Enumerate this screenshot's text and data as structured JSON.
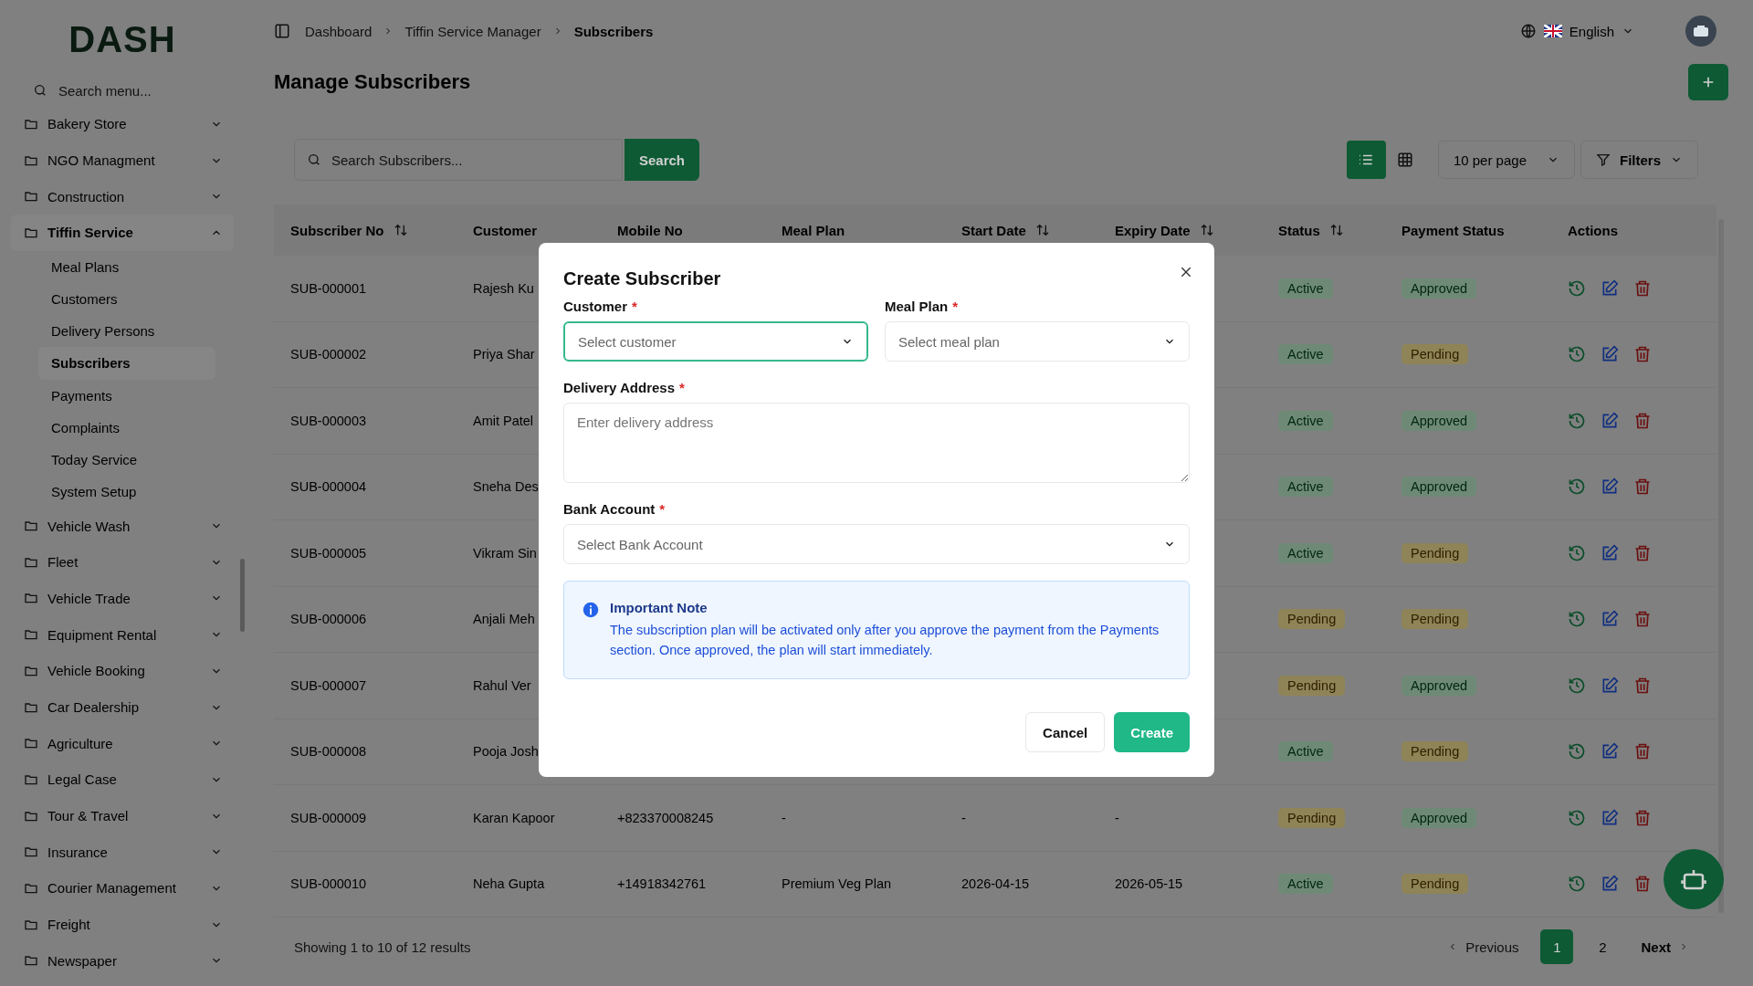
{
  "sidebar": {
    "logo": "DASH",
    "search_placeholder": "Search menu...",
    "items": [
      {
        "label": "Bakery Store",
        "expanded": false
      },
      {
        "label": "NGO Managment",
        "expanded": false
      },
      {
        "label": "Construction",
        "expanded": false
      },
      {
        "label": "Tiffin Service",
        "expanded": true,
        "children": [
          {
            "label": "Meal Plans",
            "selected": false
          },
          {
            "label": "Customers",
            "selected": false
          },
          {
            "label": "Delivery Persons",
            "selected": false
          },
          {
            "label": "Subscribers",
            "selected": true
          },
          {
            "label": "Payments",
            "selected": false
          },
          {
            "label": "Complaints",
            "selected": false
          },
          {
            "label": "Today Service",
            "selected": false
          },
          {
            "label": "System Setup",
            "selected": false
          }
        ]
      },
      {
        "label": "Vehicle Wash",
        "expanded": false
      },
      {
        "label": "Fleet",
        "expanded": false
      },
      {
        "label": "Vehicle Trade",
        "expanded": false
      },
      {
        "label": "Equipment Rental",
        "expanded": false
      },
      {
        "label": "Vehicle Booking",
        "expanded": false
      },
      {
        "label": "Car Dealership",
        "expanded": false
      },
      {
        "label": "Agriculture",
        "expanded": false
      },
      {
        "label": "Legal Case",
        "expanded": false
      },
      {
        "label": "Tour & Travel",
        "expanded": false
      },
      {
        "label": "Insurance",
        "expanded": false
      },
      {
        "label": "Courier Management",
        "expanded": false
      },
      {
        "label": "Freight",
        "expanded": false
      },
      {
        "label": "Newspaper",
        "expanded": false
      }
    ]
  },
  "header": {
    "breadcrumb": [
      "Dashboard",
      "Tiffin Service Manager",
      "Subscribers"
    ],
    "language": "English"
  },
  "page_title": "Manage Subscribers",
  "toolbar": {
    "search_placeholder": "Search Subscribers...",
    "search_button": "Search",
    "views": [
      {
        "kind": "list",
        "selected": true
      },
      {
        "kind": "grid",
        "selected": false
      }
    ],
    "per_page": "10 per page",
    "filters": "Filters"
  },
  "table": {
    "columns": [
      {
        "label": "Subscriber No",
        "sortable": true
      },
      {
        "label": "Customer",
        "sortable": false
      },
      {
        "label": "Mobile No",
        "sortable": false
      },
      {
        "label": "Meal Plan",
        "sortable": false
      },
      {
        "label": "Start Date",
        "sortable": true
      },
      {
        "label": "Expiry Date",
        "sortable": true
      },
      {
        "label": "Status",
        "sortable": true
      },
      {
        "label": "Payment Status",
        "sortable": false
      },
      {
        "label": "Actions",
        "sortable": false
      }
    ],
    "rows": [
      {
        "subscriber_no": "SUB-000001",
        "customer": "Rajesh Ku",
        "status": {
          "label": "Active",
          "kind": "success"
        },
        "payment_status": {
          "label": "Approved",
          "kind": "success"
        }
      },
      {
        "subscriber_no": "SUB-000002",
        "customer": "Priya Shar",
        "status": {
          "label": "Active",
          "kind": "success"
        },
        "payment_status": {
          "label": "Pending",
          "kind": "warning"
        }
      },
      {
        "subscriber_no": "SUB-000003",
        "customer": "Amit Patel",
        "status": {
          "label": "Active",
          "kind": "success"
        },
        "payment_status": {
          "label": "Approved",
          "kind": "success"
        }
      },
      {
        "subscriber_no": "SUB-000004",
        "customer": "Sneha Des",
        "status": {
          "label": "Active",
          "kind": "success"
        },
        "payment_status": {
          "label": "Approved",
          "kind": "success"
        }
      },
      {
        "subscriber_no": "SUB-000005",
        "customer": "Vikram Sin",
        "status": {
          "label": "Active",
          "kind": "success"
        },
        "payment_status": {
          "label": "Pending",
          "kind": "warning"
        }
      },
      {
        "subscriber_no": "SUB-000006",
        "customer": "Anjali Meh",
        "status": {
          "label": "Pending",
          "kind": "warning"
        },
        "payment_status": {
          "label": "Pending",
          "kind": "warning"
        }
      },
      {
        "subscriber_no": "SUB-000007",
        "customer": "Rahul Ver",
        "status": {
          "label": "Pending",
          "kind": "warning"
        },
        "payment_status": {
          "label": "Approved",
          "kind": "success"
        }
      },
      {
        "subscriber_no": "SUB-000008",
        "customer": "Pooja Josh",
        "status": {
          "label": "Active",
          "kind": "success"
        },
        "payment_status": {
          "label": "Pending",
          "kind": "warning"
        }
      },
      {
        "subscriber_no": "SUB-000009",
        "customer": "Karan Kapoor",
        "mobile_no": "+823370008245",
        "meal_plan": "-",
        "start_date": "-",
        "expiry_date": "-",
        "status": {
          "label": "Pending",
          "kind": "warning"
        },
        "payment_status": {
          "label": "Approved",
          "kind": "success"
        }
      },
      {
        "subscriber_no": "SUB-000010",
        "customer": "Neha Gupta",
        "mobile_no": "+14918342761",
        "meal_plan": "Premium Veg Plan",
        "start_date": "2026-04-15",
        "expiry_date": "2026-05-15",
        "status": {
          "label": "Active",
          "kind": "success"
        },
        "payment_status": {
          "label": "Pending",
          "kind": "warning"
        }
      }
    ]
  },
  "pagination": {
    "summary": "Showing 1 to 10 of 12 results",
    "previous": "Previous",
    "pages": [
      {
        "label": "1",
        "selected": true
      },
      {
        "label": "2",
        "selected": false
      }
    ],
    "next": "Next"
  },
  "modal": {
    "title": "Create Subscriber",
    "field_rows": [
      [
        {
          "kind": "select",
          "label": "Customer",
          "required_mark": "*",
          "placeholder": "Select customer",
          "focused": true
        },
        {
          "kind": "select",
          "label": "Meal Plan",
          "required_mark": "*",
          "placeholder": "Select meal plan",
          "focused": false
        }
      ],
      [
        {
          "kind": "textarea",
          "label": "Delivery Address",
          "required_mark": "*",
          "placeholder": "Enter delivery address",
          "focused": false
        }
      ],
      [
        {
          "kind": "select",
          "label": "Bank Account",
          "required_mark": "*",
          "placeholder": "Select Bank Account",
          "focused": false
        }
      ]
    ],
    "note": {
      "title": "Important Note",
      "text": "The subscription plan will be activated only after you approve the payment from the Payments section. Once approved, the plan will start immediately."
    },
    "cancel": "Cancel",
    "create": "Create"
  }
}
